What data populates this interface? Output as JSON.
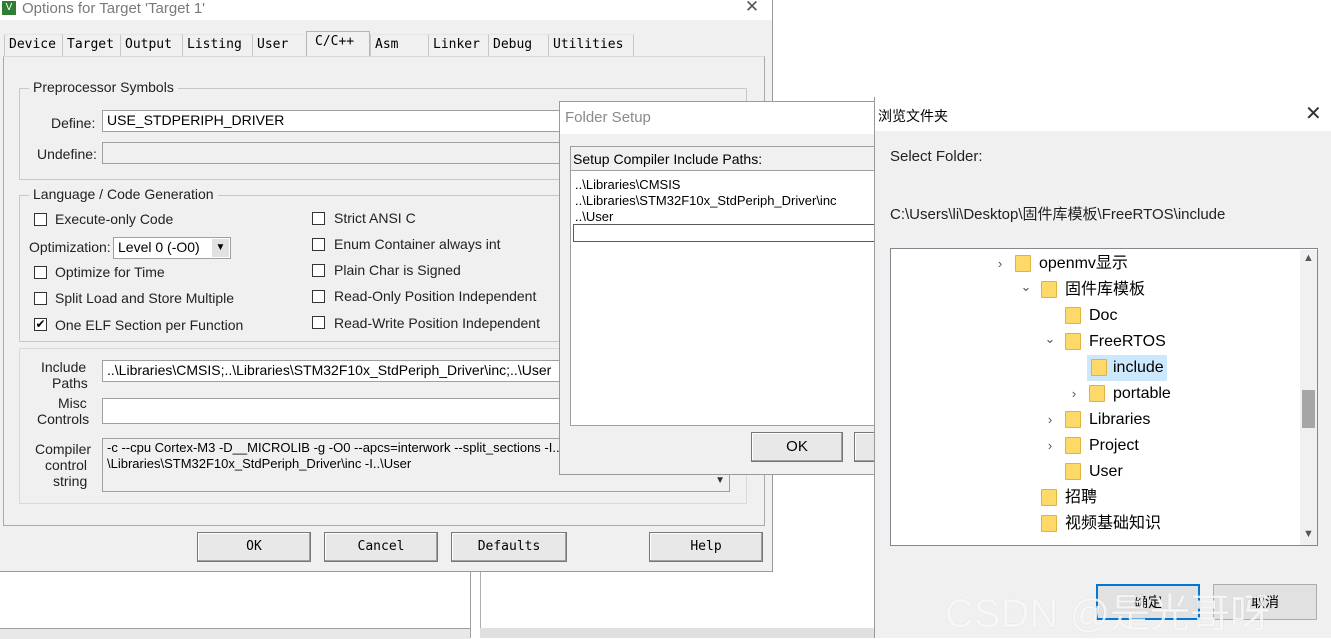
{
  "options_window": {
    "title": "Options for Target 'Target 1'",
    "close_glyph": "✕",
    "tabs": [
      "Device",
      "Target",
      "Output",
      "Listing",
      "User",
      "C/C++",
      "Asm",
      "Linker",
      "Debug",
      "Utilities"
    ],
    "active_tab": "C/C++",
    "preprocessor": {
      "group_label": "Preprocessor Symbols",
      "define_label": "Define:",
      "define_value": "USE_STDPERIPH_DRIVER",
      "undefine_label": "Undefine:",
      "undefine_value": ""
    },
    "language": {
      "group_label": "Language / Code Generation",
      "execute_only": {
        "label": "Execute-only Code",
        "checked": false
      },
      "optimization_label": "Optimization:",
      "optimization_value": "Level 0 (-O0)",
      "optimize_time": {
        "label": "Optimize for Time",
        "checked": false
      },
      "split_load": {
        "label": "Split Load and Store Multiple",
        "checked": false
      },
      "one_elf": {
        "label": "One ELF Section per Function",
        "checked": true
      },
      "strict_ansi": {
        "label": "Strict ANSI C",
        "checked": false
      },
      "enum_container": {
        "label": "Enum Container always int",
        "checked": false
      },
      "plain_char": {
        "label": "Plain Char is Signed",
        "checked": false
      },
      "ro_pi": {
        "label": "Read-Only Position Independent",
        "checked": false
      },
      "rw_pi": {
        "label": "Read-Write Position Independent",
        "checked": false
      }
    },
    "include_paths": {
      "label_1": "Include",
      "label_2": "Paths",
      "value": "..\\Libraries\\CMSIS;..\\Libraries\\STM32F10x_StdPeriph_Driver\\inc;..\\User"
    },
    "misc_controls": {
      "label_1": "Misc",
      "label_2": "Controls",
      "value": ""
    },
    "compiler_control": {
      "label_1": "Compiler",
      "label_2": "control",
      "label_3": "string",
      "line_1": "-c --cpu Cortex-M3 -D__MICROLIB -g -O0 --apcs=interwork --split_sections -I..",
      "line_2": "\\Libraries\\STM32F10x_StdPeriph_Driver\\inc -I..\\User"
    },
    "buttons": {
      "ok": "OK",
      "cancel": "Cancel",
      "defaults": "Defaults",
      "help": "Help"
    }
  },
  "folder_setup": {
    "title": "Folder Setup",
    "header": "Setup Compiler Include Paths:",
    "paths": [
      "..\\Libraries\\CMSIS",
      "..\\Libraries\\STM32F10x_StdPeriph_Driver\\inc",
      "..\\User"
    ],
    "ok_label": "OK"
  },
  "browse_dialog": {
    "title": "浏览文件夹",
    "close_glyph": "✕",
    "prompt": "Select Folder:",
    "path": "C:\\Users\\li\\Desktop\\固件库模板\\FreeRTOS\\include",
    "tree": [
      {
        "label": "openmv显示",
        "chevron": "›",
        "selected": false
      },
      {
        "label": "固件库模板",
        "chevron": "⌄",
        "selected": false
      },
      {
        "label": "Doc",
        "chevron": "",
        "selected": false
      },
      {
        "label": "FreeRTOS",
        "chevron": "⌄",
        "selected": false
      },
      {
        "label": "include",
        "chevron": "",
        "selected": true
      },
      {
        "label": "portable",
        "chevron": "›",
        "selected": false
      },
      {
        "label": "Libraries",
        "chevron": "›",
        "selected": false
      },
      {
        "label": "Project",
        "chevron": "›",
        "selected": false
      },
      {
        "label": "User",
        "chevron": "",
        "selected": false
      },
      {
        "label": "招聘",
        "chevron": "",
        "selected": false
      },
      {
        "label": "视频基础知识",
        "chevron": "",
        "selected": false
      }
    ],
    "ok_label": "确定",
    "cancel_label": "取消",
    "watermark": "CSDN @是光哥呀"
  },
  "colors": {
    "selection": "#cce8ff",
    "folder": "#ffd86a",
    "focus_border": "#0078d7"
  }
}
